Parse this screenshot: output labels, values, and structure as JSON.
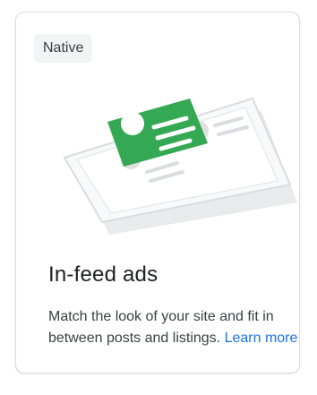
{
  "card": {
    "chip_label": "Native",
    "title": "In-feed ads",
    "description": "Match the look of your site and fit in between posts and listings.",
    "link_label": "Learn more",
    "illustration_icon": "phone-feed-illustration-icon"
  },
  "colors": {
    "accent_green": "#34a853",
    "link_blue": "#1a73e8",
    "title": "#202124",
    "body": "#3c4043",
    "chip_bg": "#f1f3f4",
    "border": "#dadce0"
  }
}
